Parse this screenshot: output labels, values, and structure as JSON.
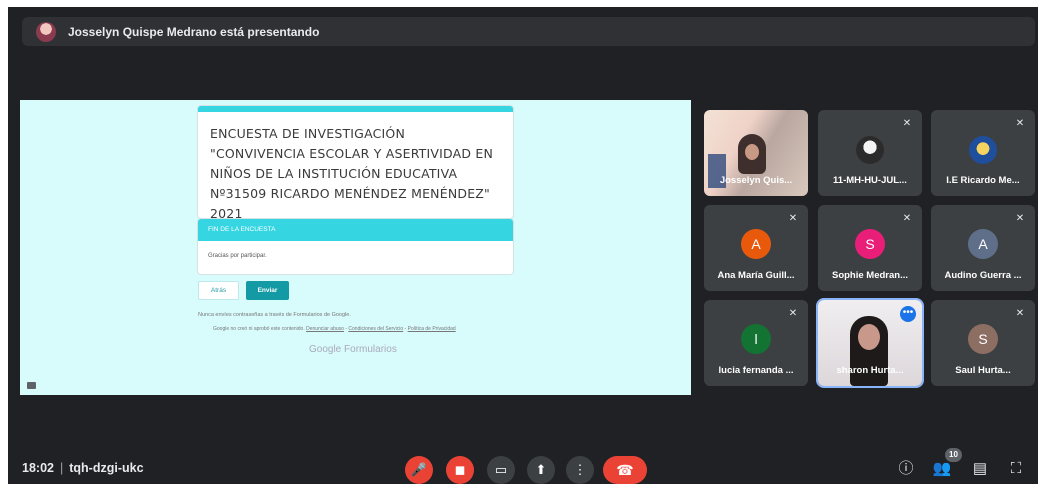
{
  "presenter": {
    "label": "Josselyn Quispe Medrano está presentando"
  },
  "form": {
    "title": "ENCUESTA DE INVESTIGACIÓN \"CONVIVENCIA ESCOLAR Y ASERTIVIDAD EN NIÑOS DE LA INSTITUCIÓN EDUCATIVA Nº31509 RICARDO MENÉNDEZ MENÉNDEZ\" 2021",
    "section_title": "FIN DE LA ENCUESTA",
    "section_text": "Gracias por participar.",
    "back_label": "Atrás",
    "send_label": "Enviar",
    "note": "Nunca envíes contraseñas a través de Formularios de Google.",
    "legal_prefix": "Google no creó ni aprobó este contenido.",
    "legal_abuse": "Denunciar abuso",
    "legal_terms": "Condiciones del Servicio",
    "legal_privacy": "Política de Privacidad",
    "legal_sep": " - ",
    "brand": "Google Formularios"
  },
  "participants": [
    {
      "name": "Josselyn Quis...",
      "kind": "video1",
      "muted": false
    },
    {
      "name": "11-MH-HU-JUL...",
      "kind": "photo",
      "muted": true
    },
    {
      "name": "I.E Ricardo Me...",
      "kind": "logo",
      "muted": true
    },
    {
      "name": "Ana María Guill...",
      "initial": "A",
      "color": "#e8590c",
      "muted": true
    },
    {
      "name": "Sophie Medran...",
      "initial": "S",
      "color": "#e91e78",
      "muted": true
    },
    {
      "name": "Audino Guerra ...",
      "initial": "A",
      "color": "#5f6f8a",
      "muted": true
    },
    {
      "name": "lucia fernanda ...",
      "initial": "l",
      "color": "#137333",
      "muted": true
    },
    {
      "name": "sharon Hurta...",
      "kind": "video2",
      "muted": false,
      "more": "•••"
    },
    {
      "name": "Saul Hurta...",
      "initial": "S",
      "color": "#8d6e63",
      "muted": true
    }
  ],
  "meeting": {
    "time": "18:02",
    "separator": "|",
    "code": "tqh-dzgi-ukc"
  },
  "controls": {
    "mic_icon": "mic-off-icon",
    "camera_icon": "camera-off-icon",
    "captions_icon": "captions-icon",
    "present_icon": "present-icon",
    "more_icon": "more-options-icon",
    "hangup_icon": "hangup-icon"
  },
  "side_controls": {
    "people_count": "10",
    "info_icon": "info-icon",
    "people_icon": "people-icon",
    "chat_icon": "chat-icon",
    "activities_icon": "activities-icon"
  },
  "colors": {
    "accent": "#35d6e2",
    "danger": "#ea4335",
    "bg": "#202124"
  }
}
